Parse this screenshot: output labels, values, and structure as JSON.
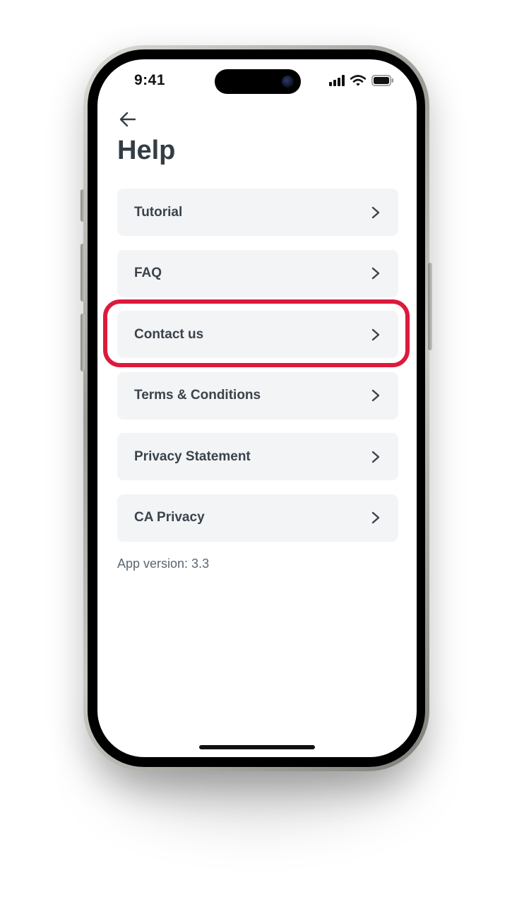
{
  "status_bar": {
    "time": "9:41",
    "icons": [
      "cellular-signal-icon",
      "wifi-icon",
      "battery-icon"
    ]
  },
  "header": {
    "back_icon": "arrow-left-icon",
    "title": "Help"
  },
  "menu": {
    "items": [
      {
        "label": "Tutorial"
      },
      {
        "label": "FAQ"
      },
      {
        "label": "Contact us"
      },
      {
        "label": "Terms & Conditions"
      },
      {
        "label": "Privacy Statement"
      },
      {
        "label": "CA Privacy"
      }
    ],
    "chevron_icon": "chevron-right-icon",
    "highlighted_item": "Contact us"
  },
  "footer": {
    "app_version": "App version: 3.3"
  },
  "colors": {
    "title": "#333d45",
    "item_background": "#f3f4f6",
    "item_text": "#3a434b",
    "version_text": "#5c6670",
    "highlight": "#dc1a3c"
  }
}
